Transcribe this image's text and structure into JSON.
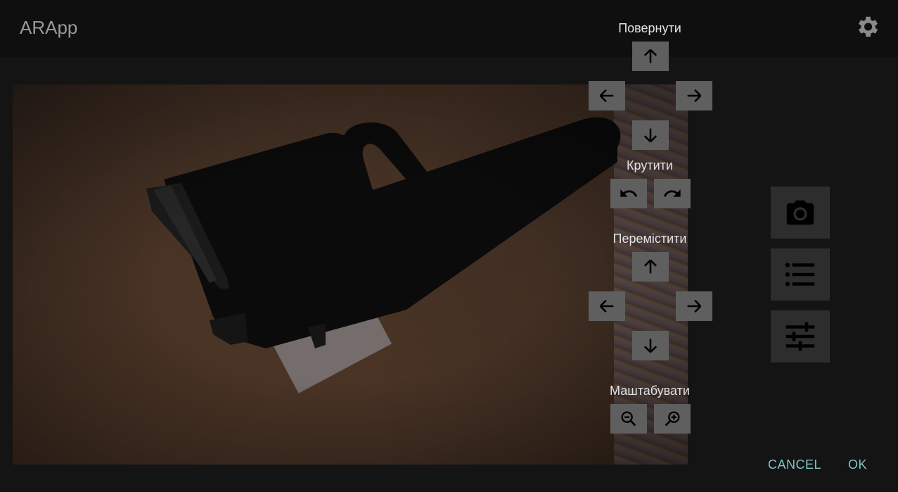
{
  "app": {
    "title": "ARApp"
  },
  "icons": {
    "settings": "gear-icon"
  },
  "controls": {
    "rotate_label": "Повернути",
    "spin_label": "Крутити",
    "move_label": "Перемістити",
    "scale_label": "Маштабувати"
  },
  "side_buttons": [
    "camera-icon",
    "list-icon",
    "sliders-icon"
  ],
  "actions": {
    "cancel": "CANCEL",
    "ok": "OK"
  },
  "colors": {
    "accent_text": "#7fc4c4",
    "button_bg": "#5f5f5f"
  }
}
